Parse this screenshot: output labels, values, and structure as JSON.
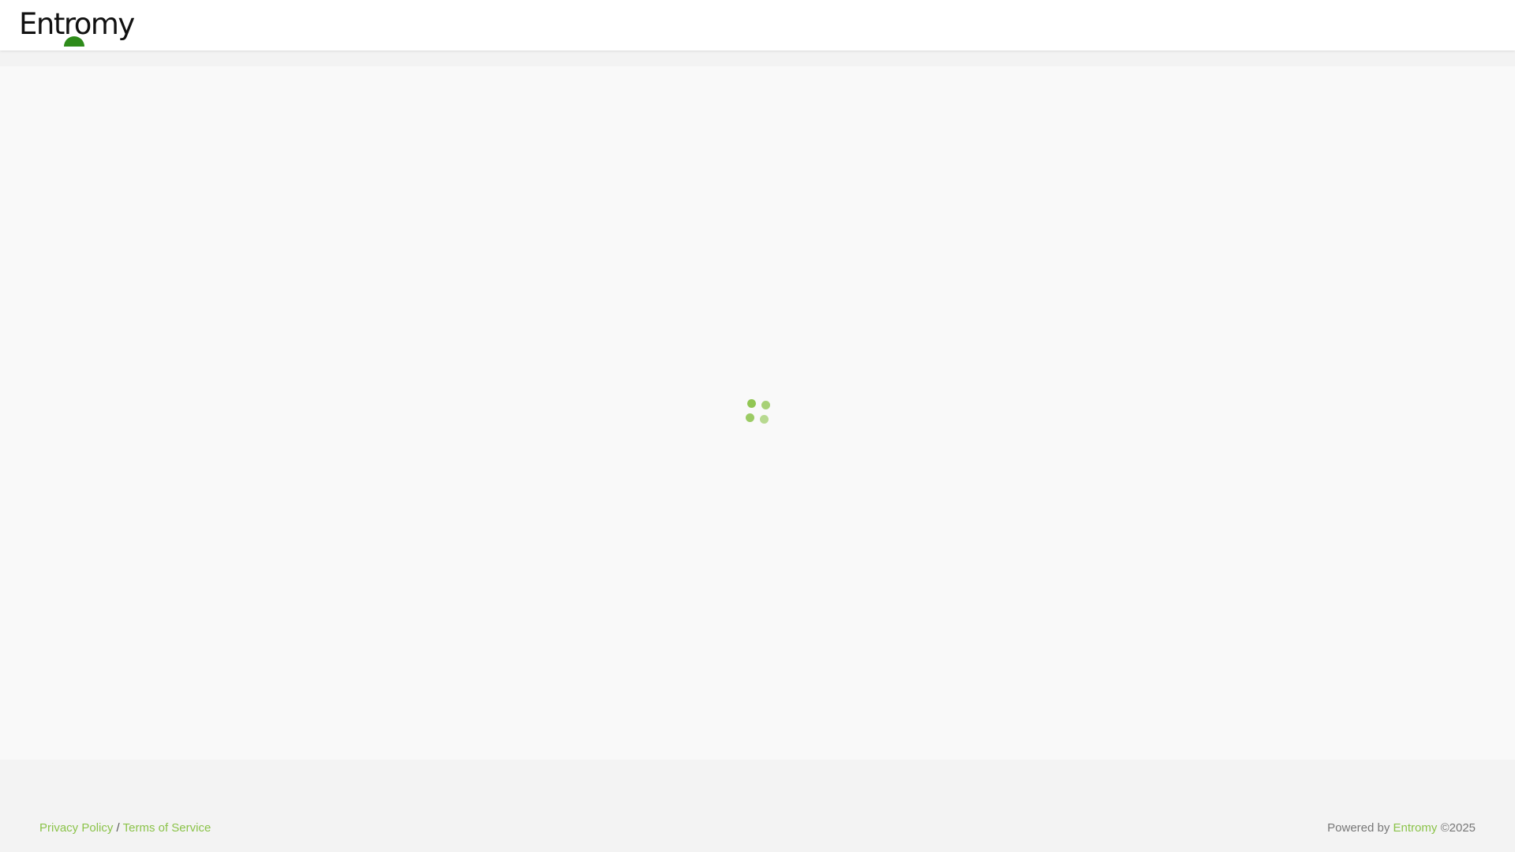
{
  "header": {
    "logo": {
      "text": "Entromy",
      "mark_color": "#2e8b1a"
    }
  },
  "main": {
    "loading_indicator": {
      "icon": "loading-spinner-icon",
      "color": "#8bc34a"
    }
  },
  "footer": {
    "privacy_label": "Privacy Policy",
    "separator": "/",
    "terms_label": "Terms of Service",
    "powered_prefix": "Powered by",
    "powered_brand": "Entromy",
    "copyright": "©2025"
  },
  "colors": {
    "accent": "#8bc34a",
    "header_bg": "#ffffff",
    "page_bg": "#f9f9f9",
    "footer_bg": "#f3f3f3"
  }
}
